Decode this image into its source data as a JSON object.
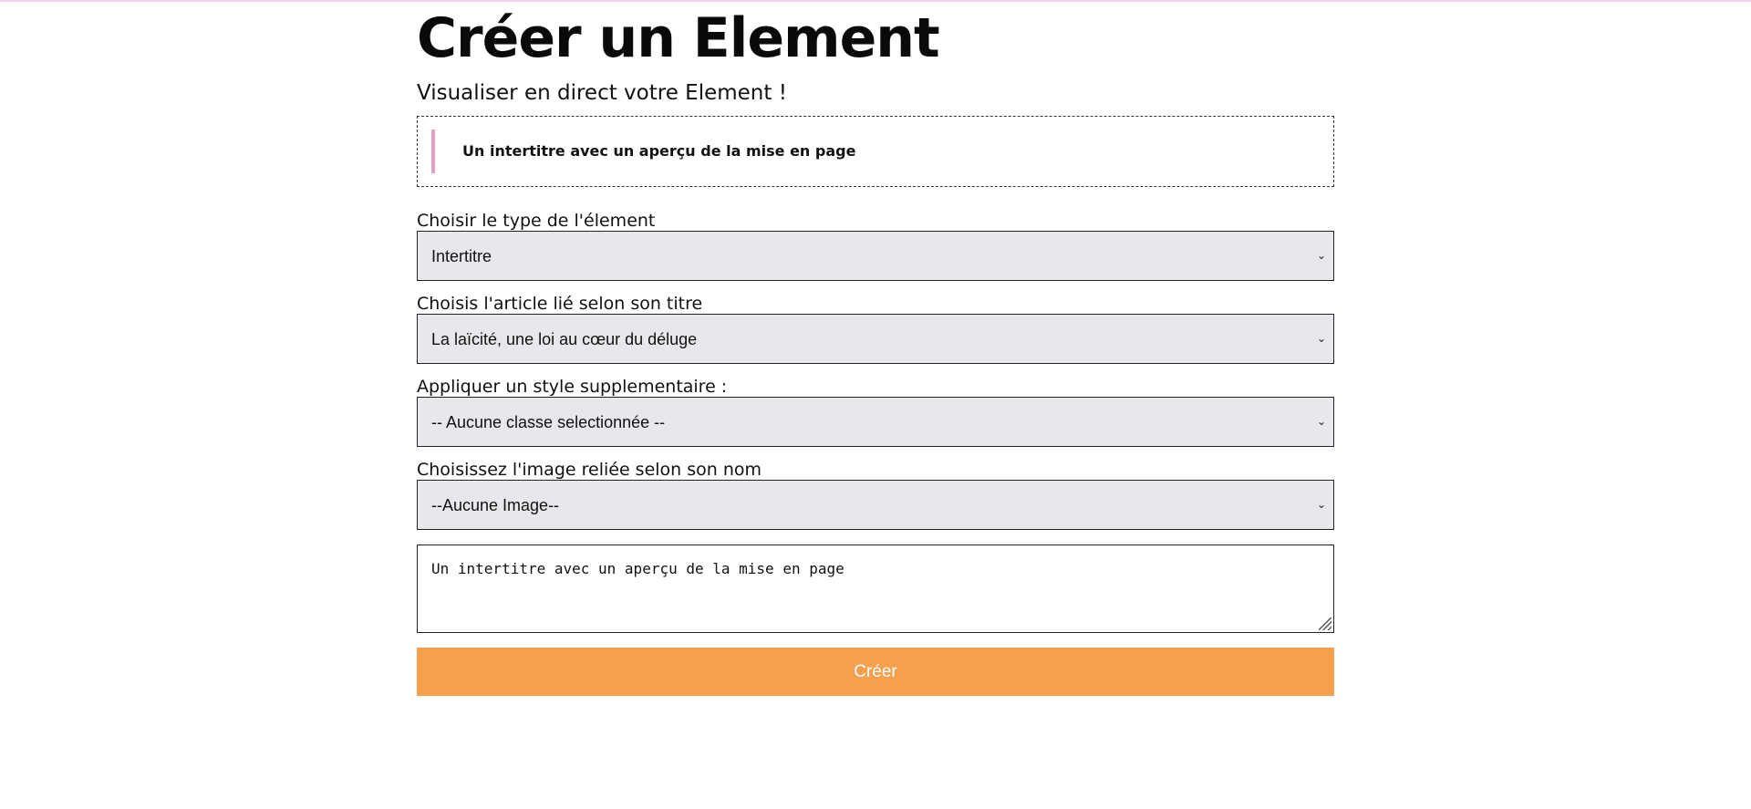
{
  "page": {
    "title": "Créer un Element",
    "subtitle": "Visualiser en direct votre Element !"
  },
  "preview": {
    "text": "Un intertitre avec un aperçu de la mise en page",
    "accent_color": "#e1a0c0"
  },
  "form": {
    "type_label": "Choisir le type de l'élement",
    "type_value": "Intertitre",
    "article_label": "Choisis l'article lié selon son titre",
    "article_value": "La laïcité, une loi au cœur du déluge",
    "style_label": "Appliquer un style supplementaire :",
    "style_value": "-- Aucune classe selectionnée --",
    "image_label": "Choisissez l'image reliée selon son nom",
    "image_value": "--Aucune Image--",
    "textarea_value": "Un intertitre avec un aperçu de la mise en page",
    "submit_label": "Créer",
    "submit_color": "#f4a04c",
    "select_chevron_icon": "chevron-down-icon"
  }
}
